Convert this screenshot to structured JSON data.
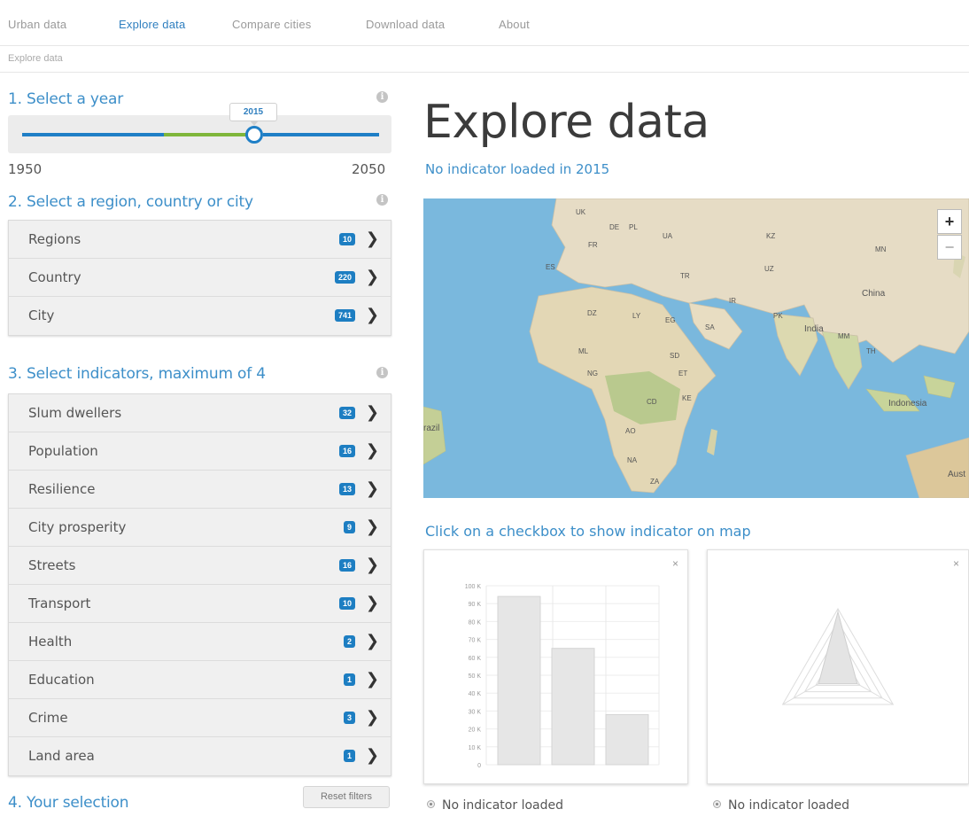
{
  "nav": {
    "items": [
      "Urban data",
      "Explore data",
      "Compare cities",
      "Download data",
      "About"
    ],
    "active_index": 1
  },
  "breadcrumb": "Explore data",
  "year_section": {
    "title": "1. Select a year",
    "selected_year": "2015",
    "min": "1950",
    "max": "2050",
    "selected_fraction": 0.65
  },
  "region_section": {
    "title": "2. Select a region, country or city",
    "items": [
      {
        "label": "Regions",
        "count": "10"
      },
      {
        "label": "Country",
        "count": "220"
      },
      {
        "label": "City",
        "count": "741"
      }
    ]
  },
  "indicator_section": {
    "title": "3. Select indicators, maximum of 4",
    "items": [
      {
        "label": "Slum dwellers",
        "count": "32"
      },
      {
        "label": "Population",
        "count": "16"
      },
      {
        "label": "Resilience",
        "count": "13"
      },
      {
        "label": "City prosperity",
        "count": "9"
      },
      {
        "label": "Streets",
        "count": "16"
      },
      {
        "label": "Transport",
        "count": "10"
      },
      {
        "label": "Health",
        "count": "2"
      },
      {
        "label": "Education",
        "count": "1"
      },
      {
        "label": "Crime",
        "count": "3"
      },
      {
        "label": "Land area",
        "count": "1"
      }
    ]
  },
  "selection_section": {
    "title": "4. Your selection",
    "reset_label": "Reset filters"
  },
  "main": {
    "title": "Explore data",
    "subtitle": "No indicator loaded in 2015",
    "hint": "Click on a checkbox to show indicator on map",
    "zoom_in": "+",
    "zoom_out": "−",
    "map_labels": [
      "UK",
      "DE",
      "PL",
      "FR",
      "UA",
      "KZ",
      "MN",
      "ES",
      "UZ",
      "TR",
      "China",
      "IR",
      "DZ",
      "LY",
      "EG",
      "SA",
      "PK",
      "India",
      "MM",
      "TH",
      "ML",
      "SD",
      "NG",
      "ET",
      "CD",
      "KE",
      "Indonesia",
      "razil",
      "AO",
      "NA",
      "ZA",
      "Aust"
    ],
    "panel_close": "×",
    "radio_label_1": "No indicator loaded",
    "radio_label_2": "No indicator loaded"
  },
  "icons": {
    "info": "info-icon",
    "chevron": "chevron-right-icon",
    "close": "close-icon",
    "radio": "radio-icon"
  },
  "colors": {
    "accent": "#3d8fc9",
    "badge": "#1d7ec2",
    "slider_blue": "#1f7fc6",
    "slider_green": "#7fb63a",
    "ocean": "#7ab8dd",
    "land": "#e6dcc5"
  },
  "chart_data": [
    {
      "type": "bar",
      "categories": [
        "",
        "",
        ""
      ],
      "values": [
        94000,
        65000,
        28000
      ],
      "yticks": [
        "100 K",
        "90 K",
        "80 K",
        "70 K",
        "60 K",
        "50 K",
        "40 K",
        "30 K",
        "20 K",
        "10 K",
        "0"
      ],
      "ylim": [
        0,
        100000
      ]
    },
    {
      "type": "radar",
      "values": [
        0.95,
        0.35,
        0.35
      ]
    }
  ]
}
